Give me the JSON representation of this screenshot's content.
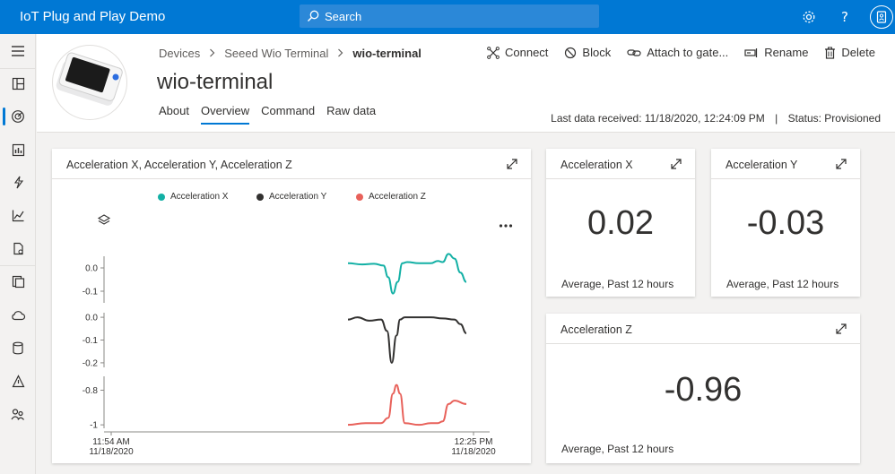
{
  "app": {
    "title": "IoT Plug and Play Demo"
  },
  "search": {
    "placeholder": "Search"
  },
  "breadcrumb": {
    "devices": "Devices",
    "template": "Seeed Wio Terminal",
    "current": "wio-terminal"
  },
  "device": {
    "name": "wio-terminal"
  },
  "tabs": [
    "About",
    "Overview",
    "Command",
    "Raw data"
  ],
  "actions": {
    "connect": "Connect",
    "block": "Block",
    "attach": "Attach to gate...",
    "rename": "Rename",
    "delete": "Delete"
  },
  "status": {
    "last_data": "Last data received: 11/18/2020, 12:24:09 PM",
    "separator": "|",
    "status": "Status: Provisioned"
  },
  "chart_card": {
    "title": "Acceleration X, Acceleration Y, Acceleration Z",
    "legend": [
      "Acceleration X",
      "Acceleration Y",
      "Acceleration Z"
    ],
    "legend_colors": [
      "#13b0a5",
      "#323130",
      "#e8615a"
    ]
  },
  "tiles": {
    "x": {
      "title": "Acceleration X",
      "value": "0.02",
      "footer": "Average, Past 12 hours"
    },
    "y": {
      "title": "Acceleration Y",
      "value": "-0.03",
      "footer": "Average, Past 12 hours"
    },
    "z": {
      "title": "Acceleration Z",
      "value": "-0.96",
      "footer": "Average, Past 12 hours"
    }
  },
  "chart_data": {
    "type": "line",
    "title": "Acceleration X, Acceleration Y, Acceleration Z",
    "x_ticks": [
      {
        "time": "11:54 AM",
        "date": "11/18/2020"
      },
      {
        "time": "12:25 PM",
        "date": "11/18/2020"
      }
    ],
    "panels": [
      {
        "name": "Acceleration X",
        "color": "#13b0a5",
        "ylim": [
          -0.15,
          0.05
        ],
        "yticks": [
          "0.0",
          "-0.1"
        ],
        "tick_values": [
          0.0,
          -0.1
        ],
        "x": [
          0.0,
          0.12,
          0.22,
          0.3,
          0.34,
          0.38,
          0.42,
          0.46,
          0.5,
          0.6,
          0.7,
          0.76,
          0.8,
          0.85,
          0.9,
          0.95,
          1.0
        ],
        "values": [
          0.02,
          0.015,
          0.018,
          0.01,
          -0.04,
          -0.11,
          -0.06,
          0.02,
          0.025,
          0.02,
          0.02,
          0.03,
          0.025,
          0.06,
          0.04,
          -0.02,
          -0.06
        ]
      },
      {
        "name": "Acceleration Y",
        "color": "#323130",
        "ylim": [
          -0.22,
          0.02
        ],
        "yticks": [
          "0.0",
          "-0.1",
          "-0.2"
        ],
        "tick_values": [
          0.0,
          -0.1,
          -0.2
        ],
        "x": [
          0.0,
          0.08,
          0.18,
          0.28,
          0.33,
          0.37,
          0.41,
          0.44,
          0.48,
          0.56,
          0.7,
          0.8,
          0.9,
          0.95,
          1.0
        ],
        "values": [
          -0.01,
          0.0,
          -0.015,
          -0.01,
          -0.06,
          -0.2,
          -0.08,
          -0.01,
          0.0,
          0.0,
          0.0,
          -0.005,
          -0.01,
          -0.03,
          -0.07
        ]
      },
      {
        "name": "Acceleration Z",
        "color": "#e8615a",
        "ylim": [
          -1.02,
          -0.72
        ],
        "yticks": [
          "-0.8",
          "-1"
        ],
        "tick_values": [
          -0.8,
          -1.0
        ],
        "x": [
          0.0,
          0.15,
          0.28,
          0.34,
          0.38,
          0.41,
          0.44,
          0.48,
          0.6,
          0.7,
          0.76,
          0.8,
          0.85,
          0.9,
          1.0
        ],
        "values": [
          -1.0,
          -0.99,
          -0.99,
          -0.96,
          -0.82,
          -0.77,
          -0.82,
          -0.99,
          -1.0,
          -0.99,
          -0.99,
          -0.98,
          -0.88,
          -0.86,
          -0.88
        ]
      }
    ]
  }
}
